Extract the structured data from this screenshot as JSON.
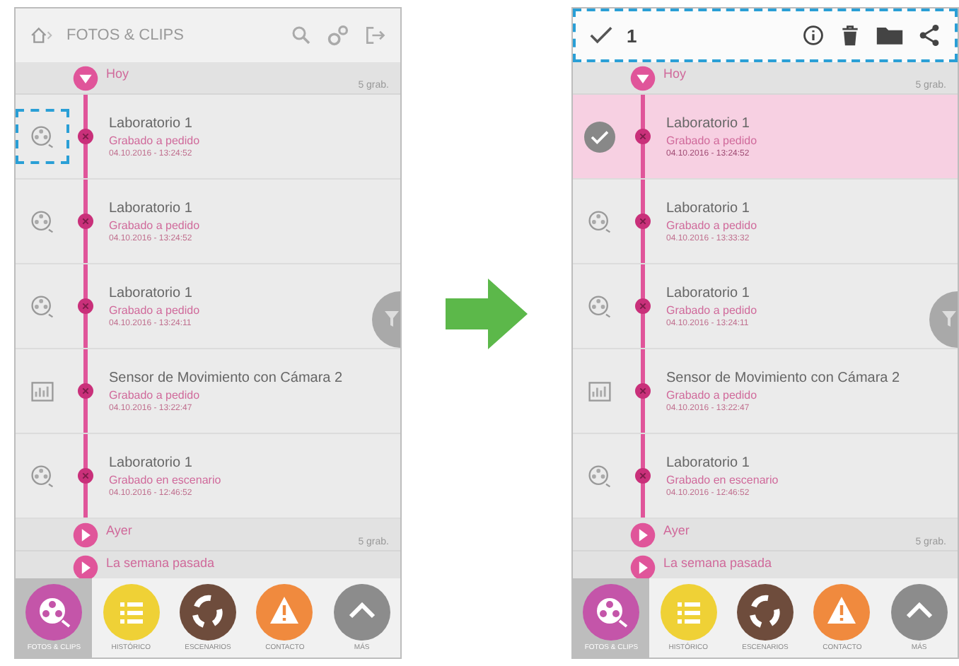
{
  "screens": [
    {
      "header": {
        "kind": "browse",
        "title": "FOTOS & CLIPS",
        "highlighted": false
      },
      "groups": [
        {
          "label": "Hoy",
          "count": "5 grab.",
          "expanded": true,
          "items": [
            {
              "kind": "video",
              "title": "Laboratorio 1",
              "subtitle": "Grabado a pedido",
              "date": "04.10.2016 - 13:24:52",
              "selected": false,
              "highlighted": true
            },
            {
              "kind": "video",
              "title": "Laboratorio 1",
              "subtitle": "Grabado a pedido",
              "date": "04.10.2016 - 13:24:52",
              "selected": false,
              "highlighted": false
            },
            {
              "kind": "video",
              "title": "Laboratorio 1",
              "subtitle": "Grabado a pedido",
              "date": "04.10.2016 - 13:24:11",
              "selected": false,
              "highlighted": false
            },
            {
              "kind": "sensor",
              "title": "Sensor de Movimiento con Cámara 2",
              "subtitle": "Grabado a pedido",
              "date": "04.10.2016 - 13:22:47",
              "selected": false,
              "highlighted": false
            },
            {
              "kind": "video",
              "title": "Laboratorio 1",
              "subtitle": "Grabado en escenario",
              "date": "04.10.2016 - 12:46:52",
              "selected": false,
              "highlighted": false
            }
          ]
        },
        {
          "label": "Ayer",
          "count": "5 grab.",
          "expanded": false
        },
        {
          "label": "La semana pasada",
          "expanded": false
        }
      ],
      "nav": [
        {
          "label": "FOTOS & CLIPS",
          "kind": "film",
          "color": "#c455a9",
          "selected": true
        },
        {
          "label": "HISTÓRICO",
          "kind": "list",
          "color": "#efd136",
          "selected": false
        },
        {
          "label": "ESCENARIOS",
          "kind": "scenes",
          "color": "#6e4c3c",
          "selected": false
        },
        {
          "label": "CONTACTO",
          "kind": "alert",
          "color": "#f08a3e",
          "selected": false
        },
        {
          "label": "MÁS",
          "kind": "up",
          "color": "#8c8c8c",
          "selected": false
        }
      ]
    },
    {
      "header": {
        "kind": "selection",
        "count": "1",
        "highlighted": true
      },
      "groups": [
        {
          "label": "Hoy",
          "count": "5 grab.",
          "expanded": true,
          "items": [
            {
              "title": "Laboratorio 1",
              "subtitle": "Grabado a pedido",
              "date": "04.10.2016 - 13:24:52",
              "selected": true,
              "highlighted": false
            },
            {
              "kind": "video",
              "title": "Laboratorio 1",
              "subtitle": "Grabado a pedido",
              "date": "04.10.2016 - 13:33:32",
              "selected": false,
              "highlighted": false
            },
            {
              "kind": "video",
              "title": "Laboratorio 1",
              "subtitle": "Grabado a pedido",
              "date": "04.10.2016 - 13:24:11",
              "selected": false,
              "highlighted": false
            },
            {
              "kind": "sensor",
              "title": "Sensor de Movimiento con Cámara 2",
              "subtitle": "Grabado a pedido",
              "date": "04.10.2016 - 13:22:47",
              "selected": false,
              "highlighted": false
            },
            {
              "kind": "video",
              "title": "Laboratorio 1",
              "subtitle": "Grabado en escenario",
              "date": "04.10.2016 - 12:46:52",
              "selected": false,
              "highlighted": false
            }
          ]
        },
        {
          "label": "Ayer",
          "count": "5 grab.",
          "expanded": false
        },
        {
          "label": "La semana pasada",
          "expanded": false
        }
      ],
      "nav": [
        {
          "label": "FOTOS & CLIPS",
          "kind": "film",
          "color": "#c455a9",
          "selected": true
        },
        {
          "label": "HISTÓRICO",
          "kind": "list",
          "color": "#efd136",
          "selected": false
        },
        {
          "label": "ESCENARIOS",
          "kind": "scenes",
          "color": "#6e4c3c",
          "selected": false
        },
        {
          "label": "CONTACTO",
          "kind": "alert",
          "color": "#f08a3e",
          "selected": false
        },
        {
          "label": "MÁS",
          "kind": "up",
          "color": "#8c8c8c",
          "selected": false
        }
      ]
    }
  ]
}
